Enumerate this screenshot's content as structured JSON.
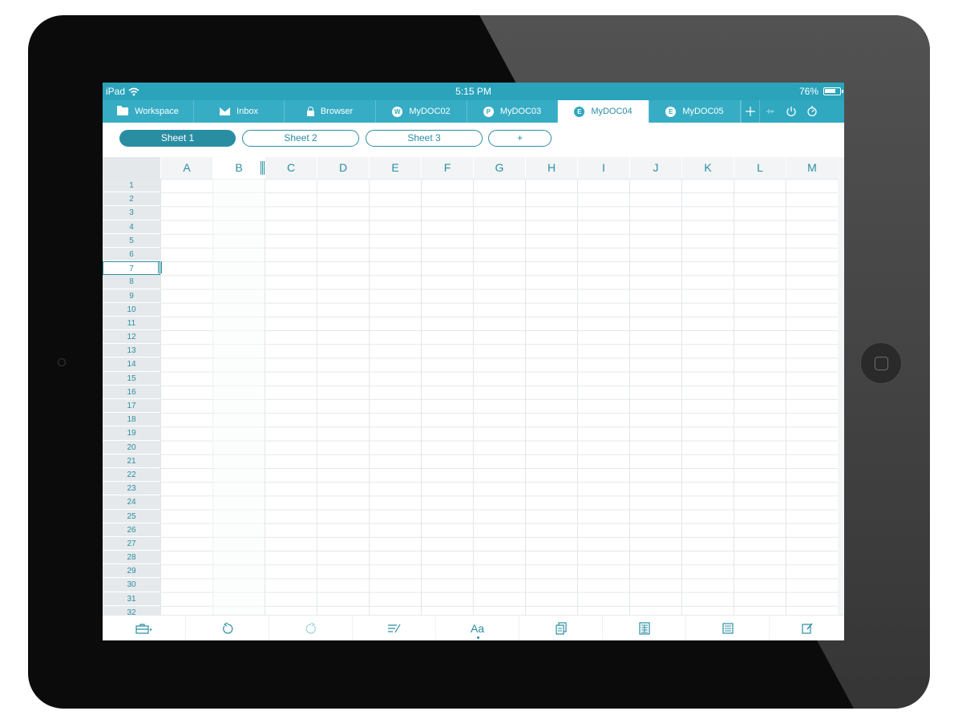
{
  "status_bar": {
    "device": "iPad",
    "time": "5:15 PM",
    "battery": "76%",
    "battery_level": 0.76
  },
  "tabs": [
    {
      "label": "Workspace",
      "icon": "folder-icon"
    },
    {
      "label": "Inbox",
      "icon": "mail-icon"
    },
    {
      "label": "Browser",
      "icon": "lock-icon"
    },
    {
      "label": "MyDOC02",
      "icon": "W"
    },
    {
      "label": "MyDOC03",
      "icon": "P"
    },
    {
      "label": "MyDOC04",
      "icon": "E",
      "active": true
    },
    {
      "label": "MyDOC05",
      "icon": "E"
    }
  ],
  "tab_actions": [
    "plus-icon",
    "pin-icon",
    "power-icon",
    "timer-icon"
  ],
  "sheets": {
    "items": [
      "Sheet 1",
      "Sheet 2",
      "Sheet 3"
    ],
    "add_label": "+",
    "active": "Sheet 1"
  },
  "grid": {
    "columns": [
      "A",
      "B",
      "C",
      "D",
      "E",
      "F",
      "G",
      "H",
      "I",
      "J",
      "K",
      "L",
      "M"
    ],
    "rows": [
      "1",
      "2",
      "3",
      "4",
      "5",
      "6",
      "7",
      "8",
      "9",
      "10",
      "11",
      "12",
      "13",
      "14",
      "15",
      "16",
      "17",
      "18",
      "19",
      "20",
      "21",
      "22",
      "23",
      "24",
      "25",
      "26",
      "27",
      "28",
      "29",
      "30",
      "31",
      "32"
    ],
    "selected_column": "B",
    "selected_row": "7"
  },
  "toolbar": [
    "toolbox-icon",
    "undo-icon",
    "redo-icon",
    "format-icon",
    "font-icon",
    "copy-icon",
    "table-icon",
    "sheet-icon",
    "edit-icon"
  ],
  "toolbar_font_label": "Aa",
  "colors": {
    "accent": "#2fa8c0",
    "accent_dark": "#2a8ea3",
    "frame": "#0b0b0b"
  }
}
